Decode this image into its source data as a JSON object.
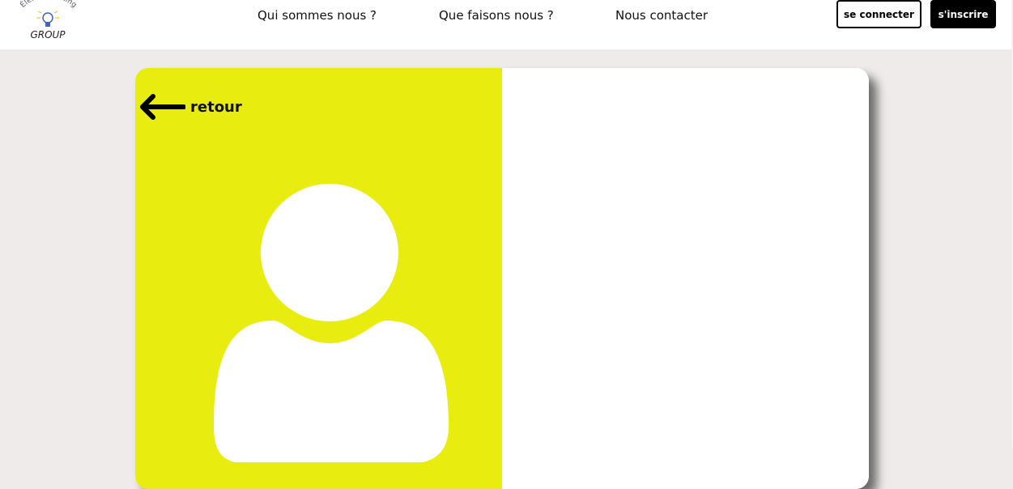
{
  "header": {
    "logo": {
      "top_text": "Élek Consulting",
      "bottom_text": "GROUP",
      "icon": "lightbulb-icon"
    },
    "nav": [
      {
        "label": "Qui sommes nous ?"
      },
      {
        "label": "Que faisons nous ?"
      },
      {
        "label": "Nous contacter"
      }
    ],
    "login_label": "se connecter",
    "signup_label": "s'inscrire"
  },
  "card": {
    "back_label": "retour",
    "back_icon": "arrow-left-icon",
    "avatar_icon": "user-avatar-icon"
  },
  "colors": {
    "page_background": "#efebea",
    "accent_yellow": "#e8ed0f",
    "card_background": "#ffffff",
    "button_dark": "#000000"
  }
}
